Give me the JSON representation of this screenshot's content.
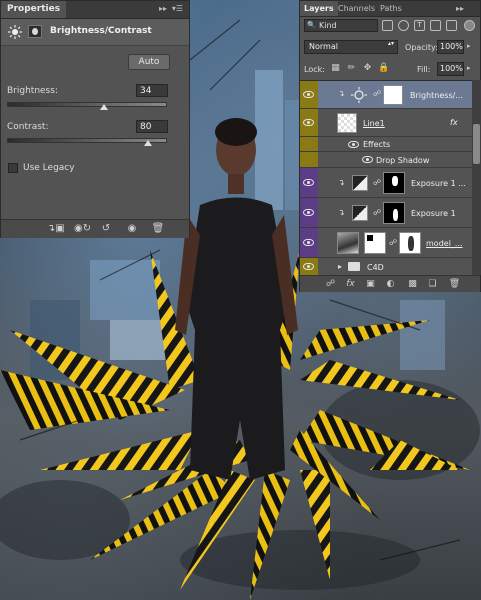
{
  "properties": {
    "tab": "Properties",
    "collapse_icon": "double-chevron-right-icon",
    "menu_icon": "panel-menu-icon",
    "adjustment_title": "Brightness/Contrast",
    "auto_label": "Auto",
    "brightness_label": "Brightness:",
    "brightness_value": "34",
    "contrast_label": "Contrast:",
    "contrast_value": "80",
    "use_legacy_label": "Use Legacy",
    "use_legacy_checked": false
  },
  "layers": {
    "tabs": [
      "Layers",
      "Channels",
      "Paths"
    ],
    "filter_kind": "Kind",
    "blend_mode": "Normal",
    "opacity_label": "Opacity:",
    "opacity_value": "100%",
    "lock_label": "Lock:",
    "fill_label": "Fill:",
    "fill_value": "100%",
    "items": [
      {
        "name": "Brightness/...",
        "label_color": "#8a7a16",
        "selected": true
      },
      {
        "name": "Line1",
        "label_color": "#8a7a16",
        "fx": "fx"
      },
      {
        "name": "Effects"
      },
      {
        "name": "Drop Shadow"
      },
      {
        "name": "Exposure 1 ...",
        "label_color": "#5b3d86"
      },
      {
        "name": "Exposure 1",
        "label_color": "#5b3d86"
      },
      {
        "name": "model_...",
        "label_color": "#5b3d86"
      },
      {
        "name": "C4D",
        "label_color": "#8a7a16"
      }
    ]
  },
  "colors": {
    "panel_bg": "#535353",
    "selected_row": "#6b7a92",
    "yellow_label": "#8a7a16",
    "violet_label": "#5b3d86",
    "stripe_yellow": "#f2c81e",
    "stripe_black": "#161616"
  }
}
